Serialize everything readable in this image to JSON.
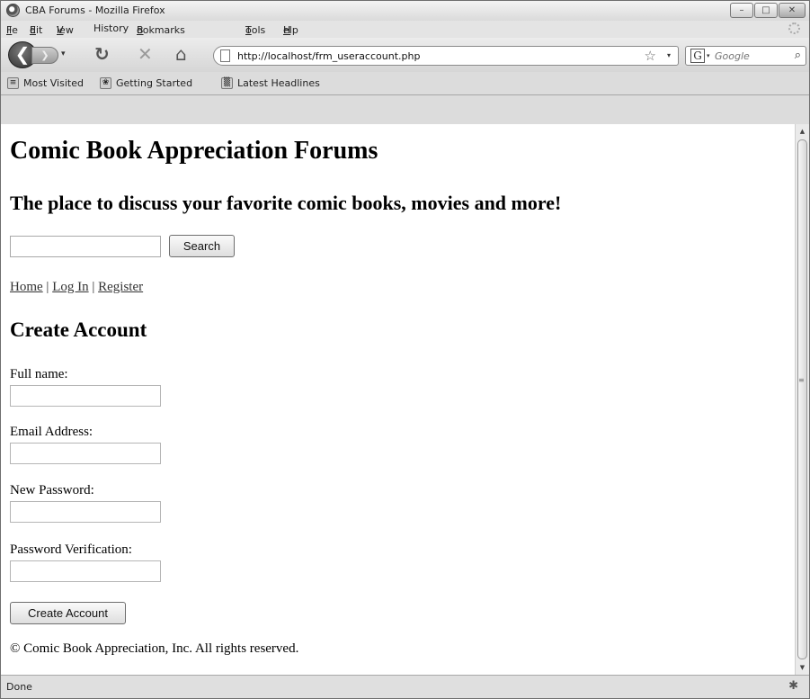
{
  "window": {
    "title": "CBA Forums - Mozilla Firefox",
    "controls": {
      "minimize": "–",
      "maximize": "□",
      "close": "✕"
    }
  },
  "menubar": {
    "items": [
      {
        "label": "File",
        "accel": "F",
        "rest": "ile"
      },
      {
        "label": "Edit",
        "accel": "E",
        "rest": "dit"
      },
      {
        "label": "View",
        "accel": "V",
        "rest": "iew"
      },
      {
        "label": "History",
        "accel": "",
        "rest": "History"
      },
      {
        "label": "Bookmarks",
        "accel": "B",
        "rest": "ookmarks"
      },
      {
        "label": "Tools",
        "accel": "T",
        "rest": "ools"
      },
      {
        "label": "Help",
        "accel": "H",
        "rest": "elp"
      }
    ]
  },
  "navbar": {
    "back_glyph": "❮",
    "forward_glyph": "❯",
    "dropdown_glyph": "▾",
    "reload_glyph": "↻",
    "stop_glyph": "✕",
    "home_glyph": "⌂",
    "url": "http://localhost/frm_useraccount.php",
    "star_glyph": "☆",
    "search_engine_letter": "G",
    "search_placeholder": "Google",
    "search_glyph": "⌕"
  },
  "bookmarks": {
    "items": [
      {
        "label": "Most Visited",
        "icon": "most-visited-icon",
        "glyph": "≡"
      },
      {
        "label": "Getting Started",
        "icon": "getting-started-icon",
        "glyph": "❀"
      },
      {
        "label": "Latest Headlines",
        "icon": "rss-feed-icon",
        "glyph": "▒"
      }
    ]
  },
  "page": {
    "site_title": "Comic Book Appreciation Forums",
    "tagline": "The place to discuss your favorite comic books, movies and more!",
    "search": {
      "value": "",
      "button_label": "Search"
    },
    "nav_links": [
      "Home",
      "Log In",
      "Register"
    ],
    "nav_separator": "|",
    "section_title": "Create Account",
    "form": {
      "fields": [
        {
          "label": "Full name:",
          "value": ""
        },
        {
          "label": "Email Address:",
          "value": ""
        },
        {
          "label": "New Password:",
          "value": ""
        },
        {
          "label": "Password Verification:",
          "value": ""
        }
      ],
      "submit_label": "Create Account"
    },
    "copyright": "© Comic Book Appreciation, Inc. All rights reserved."
  },
  "scrollbar": {
    "up_glyph": "▲",
    "down_glyph": "▼",
    "grip_glyph": "≡"
  },
  "statusbar": {
    "text": "Done",
    "icon_glyph": "✱"
  }
}
